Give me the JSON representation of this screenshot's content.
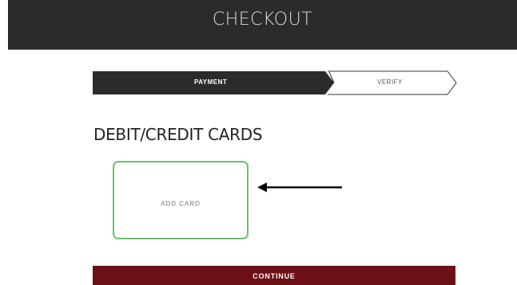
{
  "header": {
    "title": "CHECKOUT"
  },
  "steps": [
    {
      "label": "PAYMENT",
      "state": "active"
    },
    {
      "label": "VERIFY",
      "state": "inactive"
    }
  ],
  "section": {
    "title": "DEBIT/CREDIT CARDS"
  },
  "add_card": {
    "label": "ADD CARD"
  },
  "annotation": {
    "icon": "arrow-left-icon"
  },
  "continue": {
    "label": "CONTINUE"
  },
  "colors": {
    "header_bg": "#2b2b2b",
    "active_step_bg": "#2b2b2b",
    "add_card_border": "#6cbf6c",
    "continue_bg": "#6d1018"
  }
}
